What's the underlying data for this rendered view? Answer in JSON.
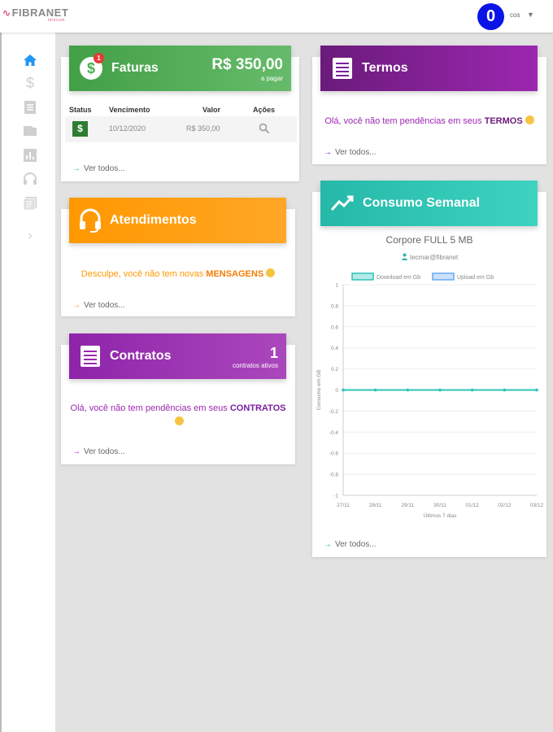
{
  "brand": {
    "name": "FIBRANET",
    "tagline": "telecom"
  },
  "user": {
    "avatar_letter": "0",
    "name": "cos"
  },
  "sidebar": {
    "items": [
      {
        "icon": "home-icon",
        "active": true
      },
      {
        "icon": "dollar-icon"
      },
      {
        "icon": "document-icon"
      },
      {
        "icon": "folder-icon"
      },
      {
        "icon": "bar-chart-icon"
      },
      {
        "icon": "headset-icon"
      },
      {
        "icon": "contract-icon"
      },
      {
        "icon": "chevron-right-icon"
      }
    ]
  },
  "faturas": {
    "title": "Faturas",
    "badge": "1",
    "amount": "R$ 350,00",
    "amount_sub": "a pagar",
    "columns": [
      "Status",
      "Vencimento",
      "Valor",
      "Ações"
    ],
    "rows": [
      {
        "status": "$",
        "vencimento": "10/12/2020",
        "valor": "R$ 350,00"
      }
    ],
    "ver_todos": "Ver todos..."
  },
  "termos": {
    "title": "Termos",
    "message_prefix": "Olá, você não tem pendências em seus",
    "message_highlight": "TERMOS",
    "ver_todos": "Ver todos..."
  },
  "atendimentos": {
    "title": "Atendimentos",
    "message_prefix": "Desculpe, você não tem novas",
    "message_highlight": "MENSAGENS",
    "ver_todos": "Ver todos..."
  },
  "contratos": {
    "title": "Contratos",
    "count": "1",
    "count_sub": "contratos ativos",
    "message_prefix": "Olá, você não tem pendências em seus",
    "message_highlight": "CONTRATOS",
    "ver_todos": "Ver todos..."
  },
  "consumo": {
    "title": "Consumo Semanal",
    "plan": "Corpore FULL 5 MB",
    "login": "tecmar@fibranet",
    "ver_todos": "Ver todos..."
  },
  "chart_data": {
    "type": "line",
    "xlabel": "Últimos 7 dias",
    "ylabel": "Consumo em GB",
    "categories": [
      "27/11",
      "28/11",
      "29/11",
      "30/11",
      "01/12",
      "02/12",
      "03/12"
    ],
    "ylim": [
      -1,
      1
    ],
    "yticks": [
      "1",
      "0.8",
      "0.6",
      "0.4",
      "0.2",
      "0",
      "-0.2",
      "-0.4",
      "-0.6",
      "-0.8",
      "-1"
    ],
    "series": [
      {
        "name": "Download em Gb",
        "values": [
          0,
          0,
          0,
          0,
          0,
          0,
          0
        ],
        "color": "#2ec4b6"
      },
      {
        "name": "Upload em Gb",
        "values": [
          0,
          0,
          0,
          0,
          0,
          0,
          0
        ],
        "color": "#6aa9f0"
      }
    ],
    "legend": "top",
    "grid": true
  },
  "colors": {
    "green": "#4caf50",
    "purple": "#7b1fa2",
    "orange": "#ff9800",
    "violet": "#9c27b0",
    "teal": "#2ec4b6",
    "brand_pink": "#e05a7a",
    "avatar_blue": "#0a14e6"
  }
}
